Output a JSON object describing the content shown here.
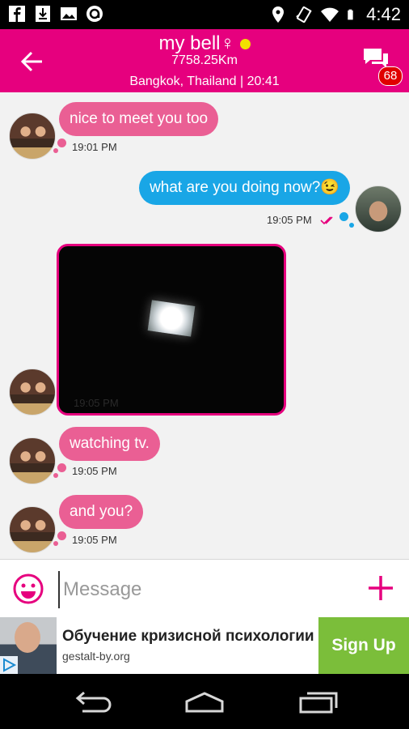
{
  "status_bar": {
    "time": "4:42"
  },
  "header": {
    "name": "my bell",
    "gender_symbol": "♀",
    "distance": "7758.25Km",
    "location": "Bangkok, Thailand",
    "local_time": "| 20:41",
    "badge": "68",
    "online_color": "#f2e000"
  },
  "messages": [
    {
      "from": "her",
      "text": "nice to meet you too",
      "time": "19:01 PM"
    },
    {
      "from": "me",
      "text": "what are you doing now?😉",
      "time": "19:05 PM"
    },
    {
      "from": "her",
      "type": "image",
      "time": "19:05 PM"
    },
    {
      "from": "her",
      "text": "watching tv.",
      "time": "19:05 PM"
    },
    {
      "from": "her",
      "text": "and you?",
      "time": "19:05 PM"
    }
  ],
  "input": {
    "placeholder": "Message"
  },
  "ad": {
    "title": "Обучение кризисной психологии",
    "url": "gestalt-by.org",
    "button": "Sign Up"
  },
  "colors": {
    "accent": "#e6007e",
    "incoming": "#ea5f94",
    "outgoing": "#19a6e6",
    "ad_button": "#7bbe3a"
  }
}
